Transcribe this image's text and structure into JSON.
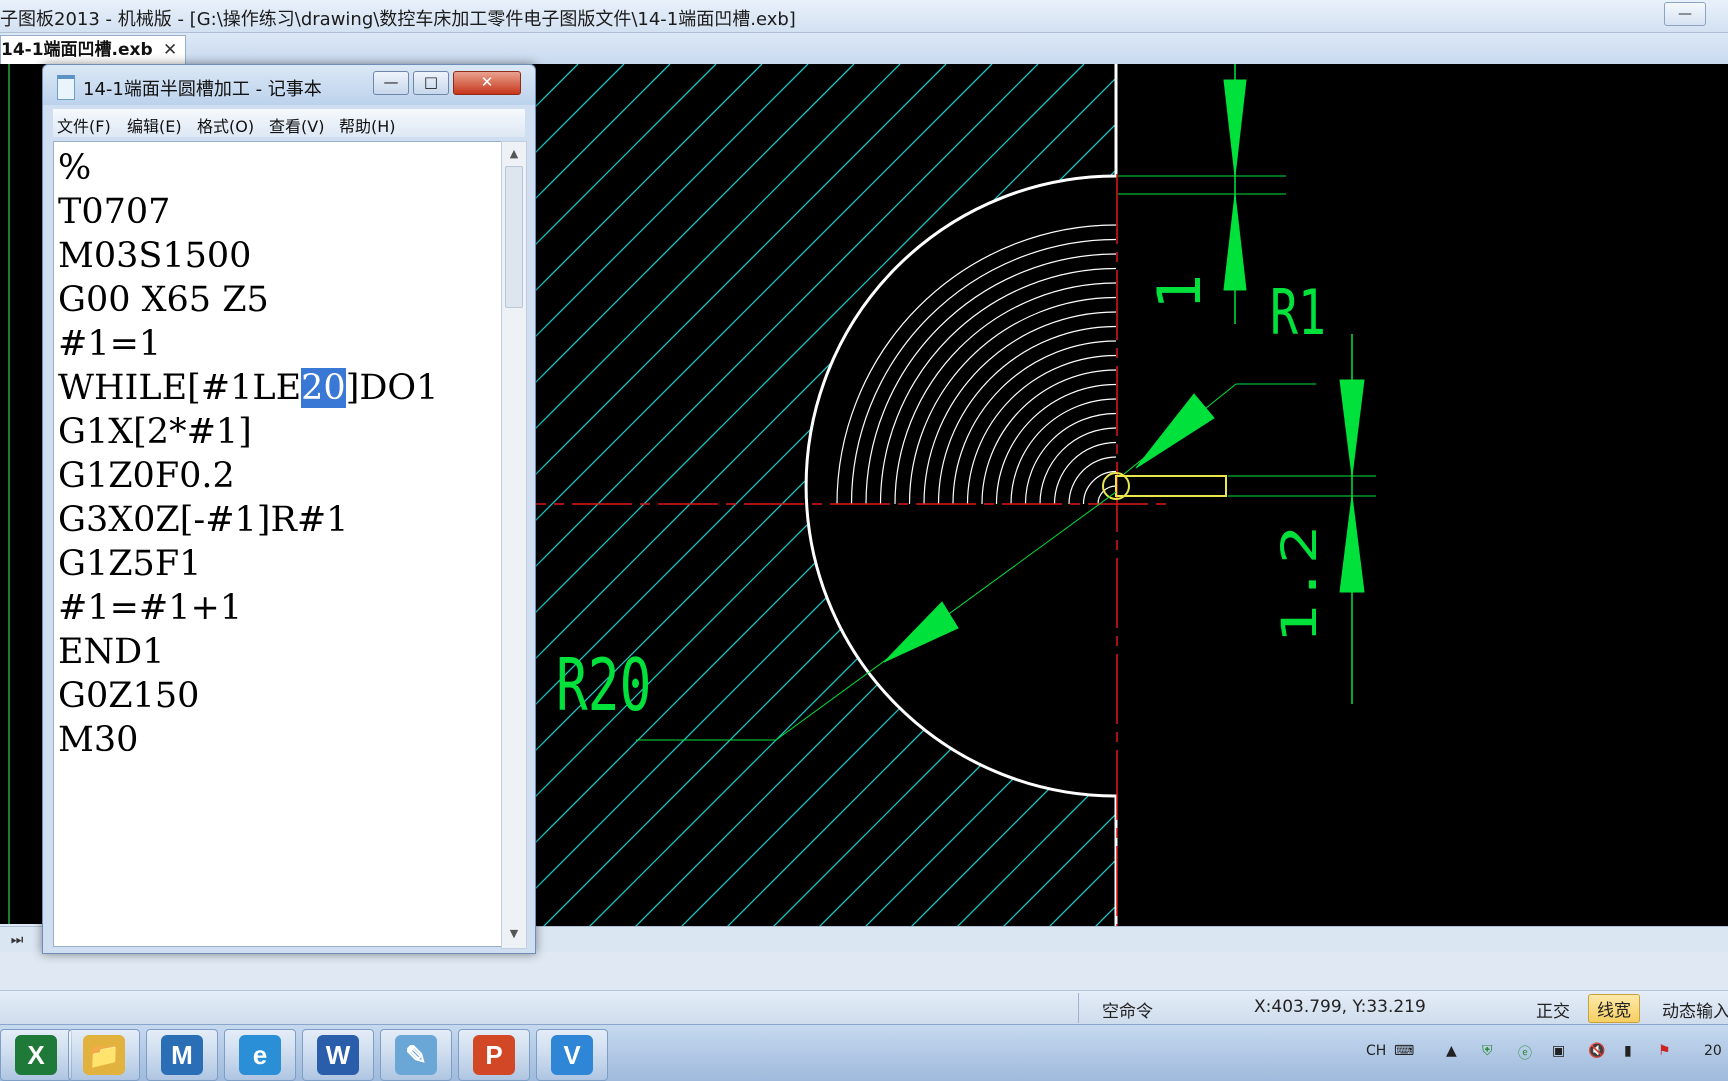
{
  "app": {
    "title": "子图板2013 - 机械版 - [G:\\操作练习\\drawing\\数控车床加工零件电子图版文件\\14-1端面凹槽.exb]",
    "tab_label": "14-1端面凹槽.exb",
    "tab_close": "✕",
    "minimize": "—"
  },
  "notepad": {
    "title": "14-1端面半圆槽加工 - 记事本",
    "buttons": {
      "minimize": "—",
      "maximize": "□",
      "close": "✕"
    },
    "menu": [
      "文件(F)",
      "编辑(E)",
      "格式(O)",
      "查看(V)",
      "帮助(H)"
    ],
    "lines": [
      "%",
      "T0707",
      "M03S1500",
      "G00 X65 Z5",
      "#1=1",
      "G1X[2*#1]",
      "G1Z0F0.2",
      "G3X0Z[-#1]R#1",
      "G1Z5F1",
      "#1=#1+1",
      "END1",
      "G0Z150",
      "M30"
    ],
    "while_line": {
      "before": "WHILE[#1LE",
      "selected": "20",
      "after": "]DO1"
    },
    "scroll_up": "▲",
    "scroll_down": "▼"
  },
  "drawing": {
    "dim_r1": "R1",
    "dim_1": "1",
    "dim_1_2": "1.2",
    "dim_r20": "R20"
  },
  "statusbar": {
    "command": "空命令",
    "coordinate": "X:403.799, Y:33.219",
    "ortho": "正交",
    "line_width": "线宽",
    "dynamic_input": "动态输入"
  },
  "taskbar": {
    "apps": [
      {
        "name": "excel",
        "glyph": "X",
        "color": "#1f7a3a"
      },
      {
        "name": "explorer",
        "glyph": "📁",
        "color": "#e2b23e"
      },
      {
        "name": "mastercam",
        "glyph": "M",
        "color": "#2a6fb6"
      },
      {
        "name": "internet-explorer",
        "glyph": "e",
        "color": "#2b8fd8"
      },
      {
        "name": "word",
        "glyph": "W",
        "color": "#2a5daa"
      },
      {
        "name": "notepad",
        "glyph": "✎",
        "color": "#6aa6d6"
      },
      {
        "name": "powerpoint",
        "glyph": "P",
        "color": "#d24726"
      },
      {
        "name": "caxa",
        "glyph": "V",
        "color": "#2f86d6"
      }
    ],
    "tray_lang": "CH",
    "clock_partial": "20"
  },
  "colors": {
    "dimension_green": "#00e23b",
    "hatch_cyan": "#1ec7c7",
    "centerline_red": "#e01919",
    "outline_white": "#ffffff",
    "tool_yellow": "#e8e84a"
  }
}
